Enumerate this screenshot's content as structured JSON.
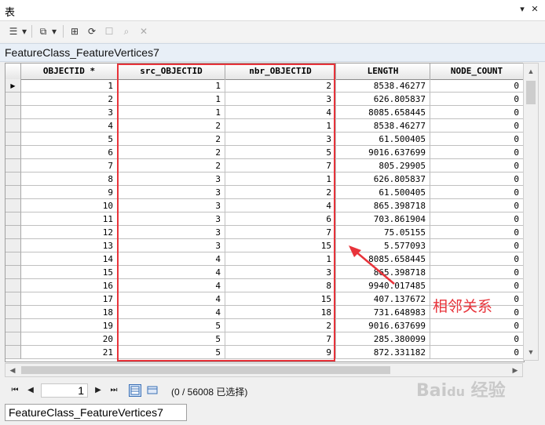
{
  "window": {
    "title": "表"
  },
  "caption": "FeatureClass_FeatureVertices7",
  "table": {
    "columns": [
      "OBJECTID *",
      "src_OBJECTID",
      "nbr_OBJECTID",
      "LENGTH",
      "NODE_COUNT"
    ],
    "rows": [
      [
        "1",
        "1",
        "2",
        "8538.46277",
        "0"
      ],
      [
        "2",
        "1",
        "3",
        "626.805837",
        "0"
      ],
      [
        "3",
        "1",
        "4",
        "8085.658445",
        "0"
      ],
      [
        "4",
        "2",
        "1",
        "8538.46277",
        "0"
      ],
      [
        "5",
        "2",
        "3",
        "61.500405",
        "0"
      ],
      [
        "6",
        "2",
        "5",
        "9016.637699",
        "0"
      ],
      [
        "7",
        "2",
        "7",
        "805.29905",
        "0"
      ],
      [
        "8",
        "3",
        "1",
        "626.805837",
        "0"
      ],
      [
        "9",
        "3",
        "2",
        "61.500405",
        "0"
      ],
      [
        "10",
        "3",
        "4",
        "865.398718",
        "0"
      ],
      [
        "11",
        "3",
        "6",
        "703.861904",
        "0"
      ],
      [
        "12",
        "3",
        "7",
        "75.05155",
        "0"
      ],
      [
        "13",
        "3",
        "15",
        "5.577093",
        "0"
      ],
      [
        "14",
        "4",
        "1",
        "8085.658445",
        "0"
      ],
      [
        "15",
        "4",
        "3",
        "865.398718",
        "0"
      ],
      [
        "16",
        "4",
        "8",
        "9940.017485",
        "0"
      ],
      [
        "17",
        "4",
        "15",
        "407.137672",
        "0"
      ],
      [
        "18",
        "4",
        "18",
        "731.648983",
        "0"
      ],
      [
        "19",
        "5",
        "2",
        "9016.637699",
        "0"
      ],
      [
        "20",
        "5",
        "7",
        "285.380099",
        "0"
      ],
      [
        "21",
        "5",
        "9",
        "872.331182",
        "0"
      ]
    ]
  },
  "navigation": {
    "current_page": "1",
    "status": "(0 / 56008 已选择)"
  },
  "bottom_tab": "FeatureClass_FeatureVertices7",
  "annotation": {
    "text": "相邻关系",
    "color": "#e8333a"
  },
  "watermark": "Baidu 经验",
  "colors": {
    "highlight": "#e8333a",
    "caption_bg": "#e8eff7"
  }
}
